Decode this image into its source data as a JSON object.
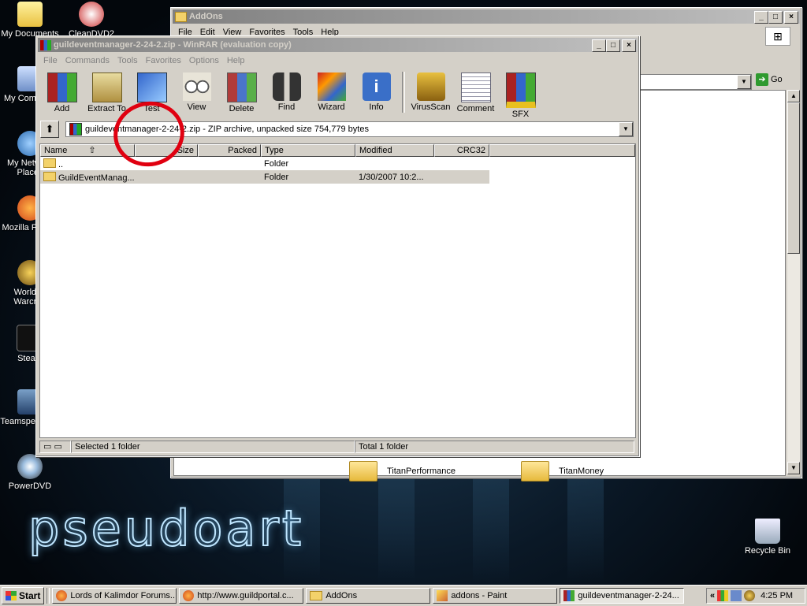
{
  "desktop": {
    "brand": "pseudoart",
    "icons": [
      "My Documents",
      "CleanDVD2",
      "My Computer",
      "My Network Places",
      "Mozilla Firefox",
      "World of Warcraft",
      "Steam",
      "Teamspeak RC",
      "PowerDVD",
      "Recycle Bin"
    ]
  },
  "addons_window": {
    "title": "AddOns",
    "menu": [
      "File",
      "Edit",
      "View",
      "Favorites",
      "Tools",
      "Help"
    ],
    "go_label": "Go",
    "folders": [
      "TitanPerformance",
      "TitanMoney"
    ]
  },
  "winrar": {
    "title": "guildeventmanager-2-24-2.zip - WinRAR (evaluation copy)",
    "menu": [
      "File",
      "Commands",
      "Tools",
      "Favorites",
      "Options",
      "Help"
    ],
    "toolbar": [
      "Add",
      "Extract To",
      "Test",
      "View",
      "Delete",
      "Find",
      "Wizard",
      "Info",
      "VirusScan",
      "Comment",
      "SFX"
    ],
    "path": "guildeventmanager-2-24-2.zip - ZIP archive, unpacked size 754,779 bytes",
    "columns": [
      "Name",
      "Size",
      "Packed",
      "Type",
      "Modified",
      "CRC32"
    ],
    "rows": [
      {
        "name": "..",
        "size": "",
        "packed": "",
        "type": "Folder",
        "modified": "",
        "crc": ""
      },
      {
        "name": "GuildEventManag...",
        "size": "",
        "packed": "",
        "type": "Folder",
        "modified": "1/30/2007 10:2...",
        "crc": ""
      }
    ],
    "status_left": "Selected 1 folder",
    "status_right": "Total 1 folder"
  },
  "taskbar": {
    "start": "Start",
    "tasks": [
      "Lords of Kalimdor Forums...",
      "http://www.guildportal.c...",
      "AddOns",
      "addons - Paint",
      "guildeventmanager-2-24..."
    ],
    "tray_chevron": "«",
    "clock": "4:25 PM"
  },
  "colors": {
    "title_active": "#0a246a",
    "annotation": "#e00010"
  }
}
